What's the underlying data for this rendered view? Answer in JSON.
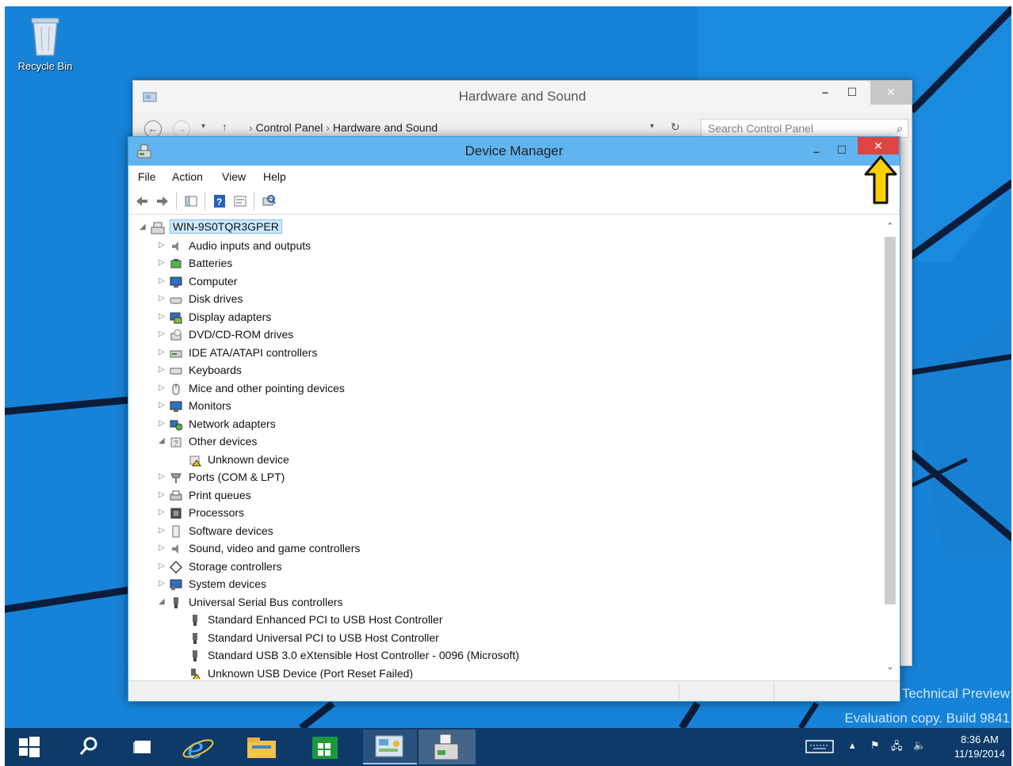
{
  "desktop": {
    "recycle_bin_label": "Recycle Bin",
    "watermark_line1": "Technical Preview",
    "watermark_line2": "Evaluation copy. Build 9841"
  },
  "hardware_sound_window": {
    "title": "Hardware and Sound",
    "min_symbol": "–",
    "max_symbol": "☐",
    "close_symbol": "✕",
    "breadcrumb": [
      "Control Panel",
      "Hardware and Sound"
    ],
    "search_placeholder": "Search Control Panel"
  },
  "device_manager": {
    "title": "Device Manager",
    "min_symbol": "–",
    "max_symbol": "☐",
    "close_symbol": "✕",
    "menu": [
      "File",
      "Action",
      "View",
      "Help"
    ],
    "root": "WIN-9S0TQR3GPER",
    "categories": [
      {
        "label": "Audio inputs and outputs",
        "icon": "speaker-icon",
        "expanded": false
      },
      {
        "label": "Batteries",
        "icon": "battery-icon",
        "expanded": false
      },
      {
        "label": "Computer",
        "icon": "computer-icon",
        "expanded": false
      },
      {
        "label": "Disk drives",
        "icon": "disk-drive-icon",
        "expanded": false
      },
      {
        "label": "Display adapters",
        "icon": "display-adapter-icon",
        "expanded": false
      },
      {
        "label": "DVD/CD-ROM drives",
        "icon": "dvd-drive-icon",
        "expanded": false
      },
      {
        "label": "IDE ATA/ATAPI controllers",
        "icon": "ide-controller-icon",
        "expanded": false
      },
      {
        "label": "Keyboards",
        "icon": "keyboard-icon",
        "expanded": false
      },
      {
        "label": "Mice and other pointing devices",
        "icon": "mouse-icon",
        "expanded": false
      },
      {
        "label": "Monitors",
        "icon": "monitor-icon",
        "expanded": false
      },
      {
        "label": "Network adapters",
        "icon": "network-adapter-icon",
        "expanded": false
      },
      {
        "label": "Other devices",
        "icon": "other-devices-icon",
        "expanded": true,
        "children": [
          {
            "label": "Unknown device",
            "icon": "unknown-device-warning-icon"
          }
        ]
      },
      {
        "label": "Ports (COM & LPT)",
        "icon": "port-icon",
        "expanded": false
      },
      {
        "label": "Print queues",
        "icon": "printer-icon",
        "expanded": false
      },
      {
        "label": "Processors",
        "icon": "processor-icon",
        "expanded": false
      },
      {
        "label": "Software devices",
        "icon": "software-device-icon",
        "expanded": false
      },
      {
        "label": "Sound, video and game controllers",
        "icon": "sound-controller-icon",
        "expanded": false
      },
      {
        "label": "Storage controllers",
        "icon": "storage-controller-icon",
        "expanded": false
      },
      {
        "label": "System devices",
        "icon": "system-device-icon",
        "expanded": false
      },
      {
        "label": "Universal Serial Bus controllers",
        "icon": "usb-icon",
        "expanded": true,
        "children": [
          {
            "label": "Standard Enhanced PCI to USB Host Controller",
            "icon": "usb-icon"
          },
          {
            "label": "Standard Universal PCI to USB Host Controller",
            "icon": "usb-icon"
          },
          {
            "label": "Standard USB 3.0 eXtensible Host Controller - 0096 (Microsoft)",
            "icon": "usb-icon"
          },
          {
            "label": "Unknown USB Device (Port Reset Failed)",
            "icon": "usb-warning-icon"
          }
        ]
      }
    ]
  },
  "taskbar": {
    "clock_time": "8:36 AM",
    "clock_date": "11/19/2014"
  },
  "colors": {
    "desktop_blue": "#1683d8",
    "dm_titlebar": "#60b4ef",
    "close_red": "#e04343",
    "taskbar": "#0d3a69",
    "pointer_yellow": "#ffd000"
  }
}
